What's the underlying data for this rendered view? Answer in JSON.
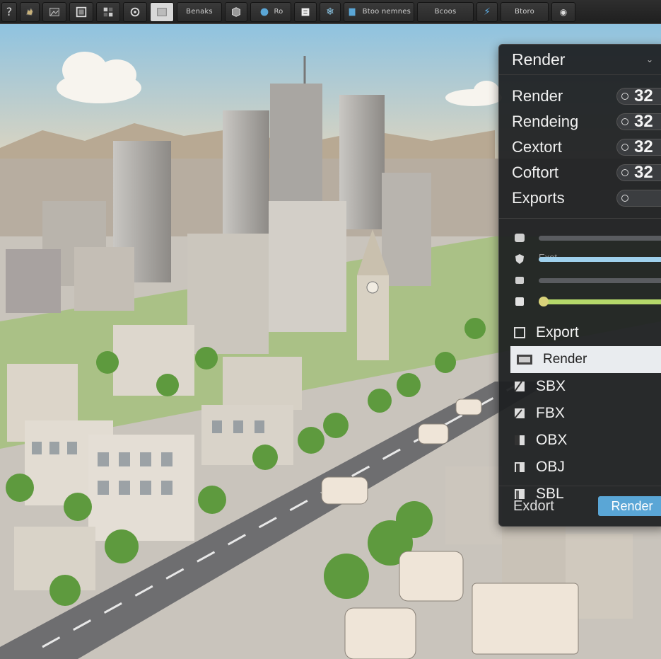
{
  "toolbar": {
    "buttons": [
      {
        "icon": "question-icon",
        "label": ""
      },
      {
        "icon": "hand-icon",
        "label": ""
      },
      {
        "icon": "image-icon",
        "label": ""
      },
      {
        "icon": "frame-icon",
        "label": ""
      },
      {
        "icon": "grid-icon",
        "label": ""
      },
      {
        "icon": "camera-icon",
        "label": ""
      },
      {
        "icon": "viewport-icon",
        "label": ""
      },
      {
        "icon": "",
        "label": "Benaks"
      },
      {
        "icon": "cube-icon",
        "label": ""
      },
      {
        "icon": "render-icon",
        "label": "Ro"
      },
      {
        "icon": "node-icon",
        "label": ""
      },
      {
        "icon": "snowflake-icon",
        "label": ""
      },
      {
        "icon": "export-icon",
        "label": "Btoo nemnes"
      },
      {
        "icon": "",
        "label": "Bcoos"
      },
      {
        "icon": "lightning-icon",
        "label": ""
      },
      {
        "icon": "",
        "label": "Btoro"
      },
      {
        "icon": "eye-icon",
        "label": ""
      }
    ]
  },
  "panel": {
    "title": "Render",
    "properties": [
      {
        "label": "Render",
        "value": "32"
      },
      {
        "label": "Rendeing",
        "value": "32"
      },
      {
        "label": "Cextort",
        "value": "32"
      },
      {
        "label": "Coftort",
        "value": "32"
      },
      {
        "label": "Exports",
        "value": ""
      }
    ],
    "sliders": [
      {
        "icon": "swatch-icon",
        "label": "",
        "level": 0.0,
        "color": "#6c6e72"
      },
      {
        "icon": "shield-icon",
        "label": "Exot",
        "level": 1.0,
        "color": "#9fd0ec"
      },
      {
        "icon": "link-icon",
        "label": "",
        "level": 0.0,
        "color": "#6c6e72"
      },
      {
        "icon": "card-icon",
        "label": "",
        "level": 1.0,
        "color": "#b5d86a"
      }
    ],
    "formats": [
      {
        "label": "Export",
        "active": false
      },
      {
        "label": "Render",
        "active": true
      },
      {
        "label": "SBX",
        "active": false
      },
      {
        "label": "FBX",
        "active": false
      },
      {
        "label": "OBX",
        "active": false
      },
      {
        "label": "OBJ",
        "active": false
      },
      {
        "label": "SBL",
        "active": false
      }
    ],
    "footer": {
      "export_label": "Exdort",
      "render_button": "Render"
    }
  }
}
